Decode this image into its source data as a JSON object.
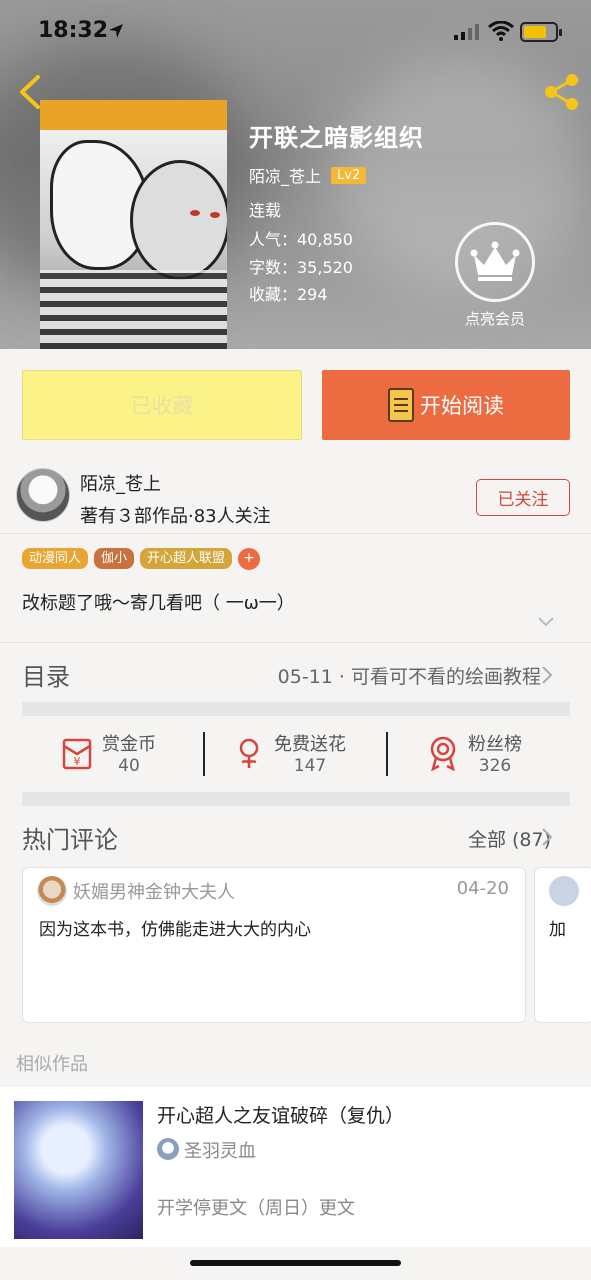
{
  "status_bar": {
    "time": "18:32"
  },
  "book": {
    "title": "开联之暗影组织",
    "author": "陌凉_苍上",
    "level": "Lv2",
    "status": "连载",
    "popularity": "人气：40,850",
    "word_count": "字数：35,520",
    "favorites": "收藏：294"
  },
  "vip": {
    "label": "点亮会员"
  },
  "actions": {
    "collected_label": "已收藏",
    "read_label": "开始阅读"
  },
  "author_info": {
    "name": "陌凉_苍上",
    "stats": "著有３部作品·83人关注",
    "follow_label": "已关注"
  },
  "tags": [
    {
      "label": "动漫同人",
      "color": "#e9a531"
    },
    {
      "label": "伽小",
      "color": "#c9723f"
    },
    {
      "label": "开心超人联盟",
      "color": "#d4a53a"
    }
  ],
  "tag_add": "+",
  "description": "改标题了哦～寄几看吧（ 一ω一）",
  "toc": {
    "label": "目录",
    "latest": "05-11 · 可看可不看的绘画教程"
  },
  "stats": [
    {
      "label": "赏金币",
      "value": "40",
      "icon": "red-envelope-icon"
    },
    {
      "label": "免费送花",
      "value": "147",
      "icon": "flower-icon"
    },
    {
      "label": "粉丝榜",
      "value": "326",
      "icon": "medal-icon"
    }
  ],
  "hot_comments": {
    "label": "热门评论",
    "all": "全部 (87)",
    "items": [
      {
        "user": "妖媚男神金钟大夫人",
        "date": "04-20",
        "text": "因为这本书，仿佛能走进大大的内心"
      },
      {
        "text": "加"
      }
    ]
  },
  "similar": {
    "label": "相似作品",
    "items": [
      {
        "title": "开心超人之友谊破碎（复仇）",
        "author": "圣羽灵血",
        "desc": "开学停更文（周日）更文"
      }
    ]
  },
  "colors": {
    "accent": "#ec6b41",
    "collected_bg": "#fbf387",
    "follow": "#d24a3f",
    "lv_badge": "#f5b833"
  }
}
